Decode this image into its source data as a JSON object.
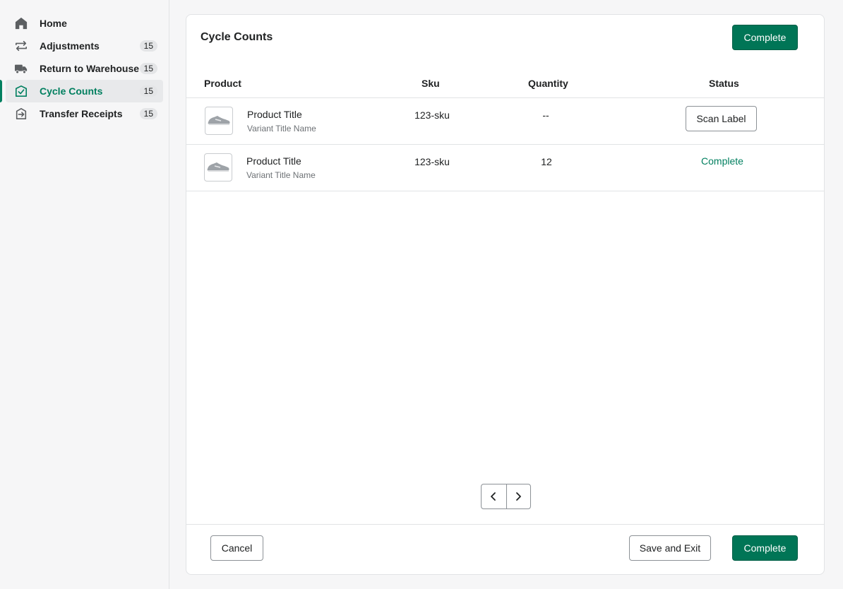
{
  "sidebar": {
    "items": [
      {
        "label": "Home",
        "icon": "home-icon",
        "badge": null
      },
      {
        "label": "Adjustments",
        "icon": "arrows-exchange-icon",
        "badge": "15"
      },
      {
        "label": "Return to Warehouse",
        "icon": "truck-icon",
        "badge": "15"
      },
      {
        "label": "Cycle Counts",
        "icon": "inventory-check-icon",
        "badge": "15"
      },
      {
        "label": "Transfer Receipts",
        "icon": "transfer-receipt-icon",
        "badge": "15"
      }
    ],
    "active_item": "Cycle Counts"
  },
  "card": {
    "title": "Cycle Counts",
    "complete_label": "Complete"
  },
  "table": {
    "headers": {
      "product": "Product",
      "sku": "Sku",
      "quantity": "Quantity",
      "status": "Status"
    },
    "rows": [
      {
        "product_title": "Product Title",
        "variant": "Variant Title Name",
        "sku": "123-sku",
        "quantity": "--",
        "status": "Scan Label"
      },
      {
        "product_title": "Product Title",
        "variant": "Variant Title Name",
        "sku": "123-sku",
        "quantity": "12",
        "status": "Complete"
      }
    ]
  },
  "footer": {
    "cancel_label": "Cancel",
    "save_exit_label": "Save and Exit",
    "complete_label": "Complete"
  },
  "colors": {
    "primary": "#007556",
    "accent_text": "#007f5f",
    "background": "#f6f6f7"
  }
}
